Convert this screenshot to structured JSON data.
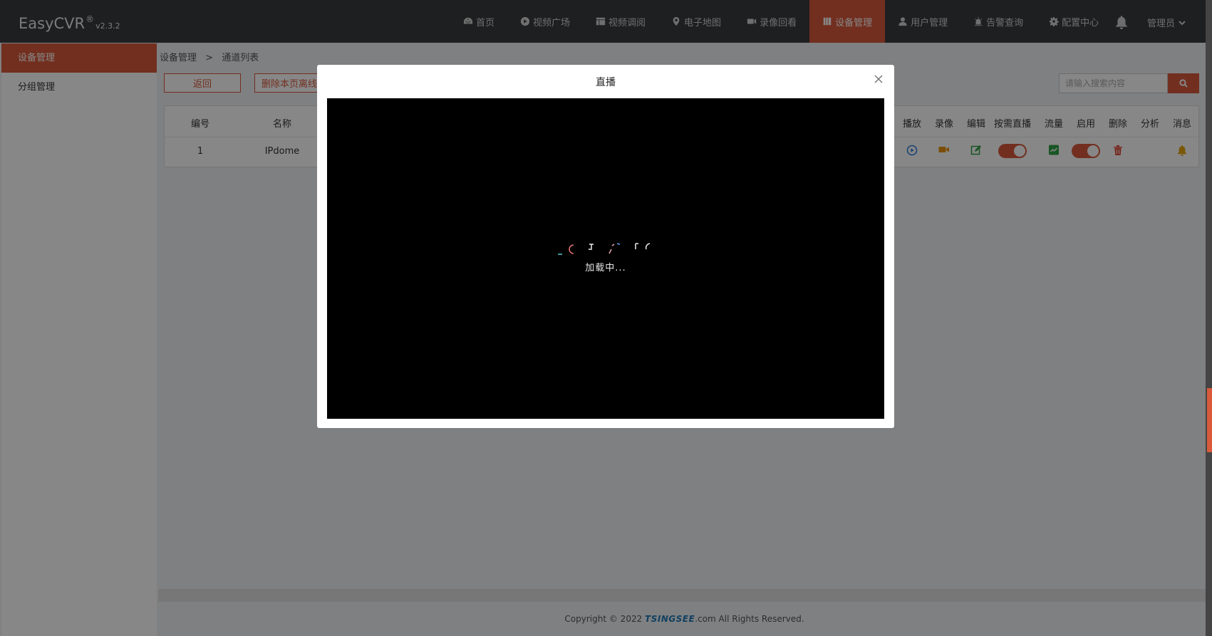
{
  "app": {
    "name": "EasyCVR",
    "registered": "®",
    "version": "v2.3.2"
  },
  "nav": {
    "items": [
      {
        "label": "首页",
        "icon": "dashboard-icon"
      },
      {
        "label": "视频广场",
        "icon": "play-circle-icon"
      },
      {
        "label": "视频调阅",
        "icon": "layout-icon"
      },
      {
        "label": "电子地图",
        "icon": "map-pin-icon"
      },
      {
        "label": "录像回看",
        "icon": "video-camera-icon"
      },
      {
        "label": "设备管理",
        "icon": "device-icon",
        "active": true
      },
      {
        "label": "用户管理",
        "icon": "user-icon"
      },
      {
        "label": "告警查询",
        "icon": "alarm-icon"
      },
      {
        "label": "配置中心",
        "icon": "gear-icon"
      }
    ],
    "user": "管理员"
  },
  "sidebar": {
    "items": [
      {
        "label": "设备管理",
        "active": true
      },
      {
        "label": "分组管理"
      }
    ]
  },
  "breadcrumb": {
    "root": "设备管理",
    "separator": ">",
    "current": "通道列表"
  },
  "toolbar": {
    "back_label": "返回",
    "delete_offline_label": "删除本页离线通道",
    "search_placeholder": "请输入搜索内容"
  },
  "table": {
    "headers": {
      "id": "编号",
      "name": "名称",
      "play": "播放",
      "record": "录像",
      "edit": "编辑",
      "on_demand": "按需直播",
      "traffic": "流量",
      "enable": "启用",
      "delete": "删除",
      "analysis": "分析",
      "message": "消息"
    },
    "rows": [
      {
        "id": "1",
        "name": "IPdome",
        "on_demand": true,
        "enabled": true
      }
    ]
  },
  "modal": {
    "title": "直播",
    "loading_text": "加载中..."
  },
  "footer": {
    "prefix": "Copyright © 2022 ",
    "brand": "TSINGSEE",
    "suffix": ".com All Rights Reserved."
  },
  "colors": {
    "accent": "#d85a3b",
    "header_bg": "#393b3f"
  }
}
